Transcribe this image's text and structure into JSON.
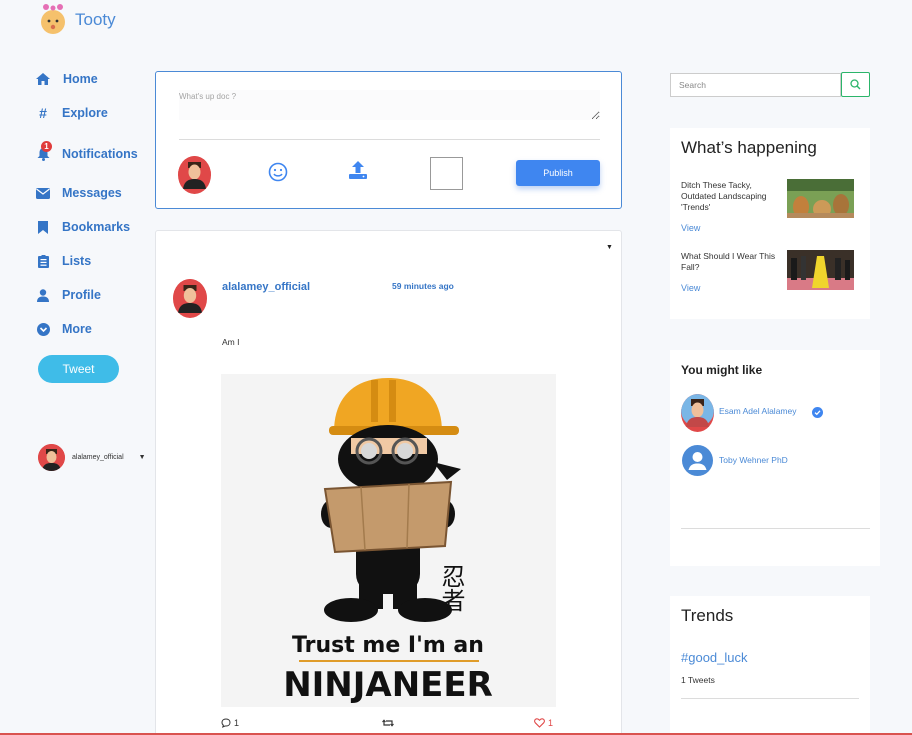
{
  "app": {
    "title": "Tooty"
  },
  "nav": {
    "items": [
      {
        "label": "Home",
        "icon": "home-icon"
      },
      {
        "label": "Explore",
        "icon": "hash-icon"
      },
      {
        "label": "Notifications",
        "icon": "bell-icon",
        "badge": "1"
      },
      {
        "label": "Messages",
        "icon": "envelope-icon"
      },
      {
        "label": "Bookmarks",
        "icon": "bookmark-icon"
      },
      {
        "label": "Lists",
        "icon": "list-icon"
      },
      {
        "label": "Profile",
        "icon": "user-icon"
      },
      {
        "label": "More",
        "icon": "chevron-circle-icon"
      }
    ],
    "tweet_label": "Tweet",
    "current_user": "alalamey_official"
  },
  "compose": {
    "placeholder": "What's up doc ?",
    "publish_label": "Publish"
  },
  "post": {
    "username": "alalamey_official",
    "time": "59 minutes ago",
    "text": "Am I",
    "image_caption_top": "Trust me I'm an",
    "image_caption_bottom": "NINJANEER",
    "image_kanji": "忍者",
    "comments": "1",
    "likes": "1"
  },
  "search": {
    "placeholder": "Search"
  },
  "happening": {
    "title": "What’s happening",
    "items": [
      {
        "title": "Ditch These Tacky, Outdated Landscaping 'Trends'",
        "view": "View"
      },
      {
        "title": "What Should I Wear This Fall?",
        "view": "View"
      }
    ]
  },
  "might_like": {
    "title": "You might like",
    "people": [
      {
        "name": "Esam Adel Alalamey",
        "verified": true
      },
      {
        "name": "Toby Wehner PhD",
        "verified": false
      }
    ]
  },
  "trends": {
    "title": "Trends",
    "items": [
      {
        "tag": "#good_luck",
        "count": "1 Tweets"
      }
    ]
  },
  "colors": {
    "accent": "#3575c6",
    "tweet_button": "#3fbce8",
    "publish": "#3f86f0",
    "like": "#e04848"
  }
}
